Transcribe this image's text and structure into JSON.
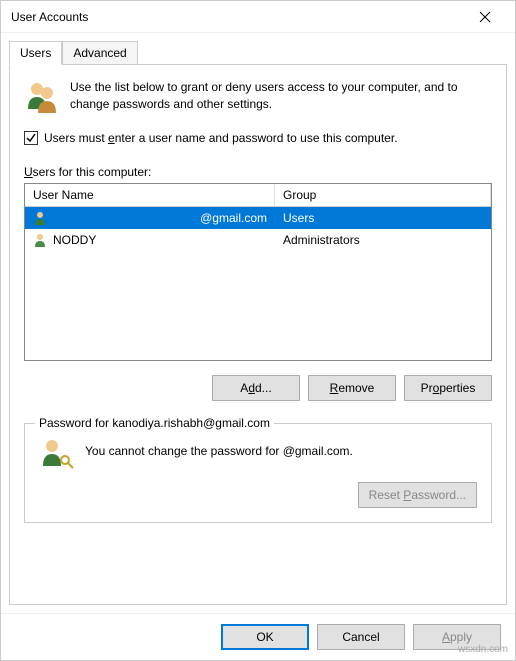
{
  "window": {
    "title": "User Accounts"
  },
  "tabs": {
    "users": "Users",
    "advanced": "Advanced"
  },
  "intro": {
    "text": "Use the list below to grant or deny users access to your computer, and to change passwords and other settings."
  },
  "checkbox": {
    "label": "Users must enter a user name and password to use this computer.",
    "checked": true
  },
  "list": {
    "label": "Users for this computer:",
    "columns": {
      "name": "User Name",
      "group": "Group"
    },
    "rows": [
      {
        "name": "@gmail.com",
        "group": "Users",
        "selected": true
      },
      {
        "name": "NODDY",
        "group": "Administrators",
        "selected": false
      }
    ]
  },
  "buttons": {
    "add": "Add...",
    "remove": "Remove",
    "properties": "Properties"
  },
  "passwordGroup": {
    "title": "Password for kanodiya.rishabh@gmail.com",
    "message": "You cannot change the password for @gmail.com.",
    "resetButton": "Reset Password..."
  },
  "dialog": {
    "ok": "OK",
    "cancel": "Cancel",
    "apply": "Apply"
  },
  "watermark": "wsxdn.com"
}
